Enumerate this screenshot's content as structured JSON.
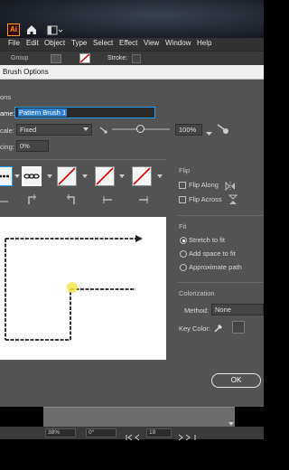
{
  "app": {
    "logo_text": "Ai",
    "menu": [
      "File",
      "Edit",
      "Object",
      "Type",
      "Select",
      "Effect",
      "View",
      "Window",
      "Help"
    ],
    "control_bar": {
      "group_label": "Group",
      "stroke_label": "Stroke:"
    }
  },
  "dialog": {
    "title": "Brush Options",
    "options_label": "ons",
    "name_label": "ame:",
    "name_value": "Pattern Brush 1",
    "scale_label": "cale:",
    "scale_value": "Fixed",
    "scale_percent": "100%",
    "spacing_label": "cing:",
    "spacing_value": "0%",
    "flip": {
      "title": "Flip",
      "along_label": "Flip Along",
      "across_label": "Flip Across"
    },
    "fit": {
      "title": "Fit",
      "options": [
        "Stretch to fit",
        "Add space to fit",
        "Approximate path"
      ],
      "selected_index": 0
    },
    "colorization": {
      "title": "Colorization",
      "method_label": "Method:",
      "method_value": "None",
      "key_color_label": "Key Color:"
    },
    "ok_label": "OK"
  },
  "status": {
    "zoom": "38%",
    "rotation": "0°",
    "artboard": "19"
  },
  "colors": {
    "accent_blue": "#2f7fd1",
    "dialog_bg": "#535353",
    "illustrator_orange": "#ff9a00"
  }
}
